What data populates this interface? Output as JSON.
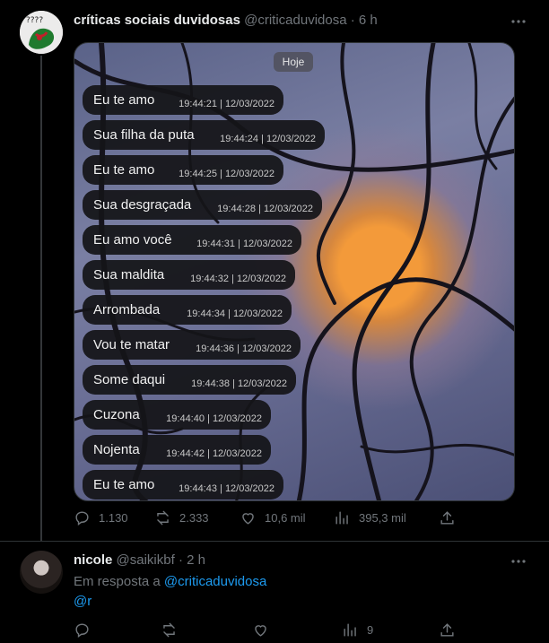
{
  "tweet": {
    "author_name": "críticas sociais duvidosas",
    "handle": "@criticaduvidosa",
    "time": "6 h",
    "media": {
      "day_label": "Hoje",
      "messages": [
        {
          "text": "Eu te amo",
          "timestamp": "19:44:21 | 12/03/2022"
        },
        {
          "text": "Sua filha da puta",
          "timestamp": "19:44:24 | 12/03/2022"
        },
        {
          "text": "Eu te amo",
          "timestamp": "19:44:25 | 12/03/2022"
        },
        {
          "text": "Sua desgraçada",
          "timestamp": "19:44:28 | 12/03/2022"
        },
        {
          "text": "Eu amo você",
          "timestamp": "19:44:31 | 12/03/2022"
        },
        {
          "text": "Sua maldita",
          "timestamp": "19:44:32 | 12/03/2022"
        },
        {
          "text": "Arrombada",
          "timestamp": "19:44:34 | 12/03/2022"
        },
        {
          "text": "Vou te matar",
          "timestamp": "19:44:36 | 12/03/2022"
        },
        {
          "text": "Some daqui",
          "timestamp": "19:44:38 | 12/03/2022"
        },
        {
          "text": "Cuzona",
          "timestamp": "19:44:40 | 12/03/2022"
        },
        {
          "text": "Nojenta",
          "timestamp": "19:44:42 | 12/03/2022"
        },
        {
          "text": "Eu te amo",
          "timestamp": "19:44:43 | 12/03/2022"
        }
      ]
    },
    "stats": {
      "replies": "1.130",
      "retweets": "2.333",
      "likes": "10,6 mil",
      "views": "395,3 mil"
    },
    "icons": [
      "reply-icon",
      "retweet-icon",
      "like-icon",
      "views-icon",
      "share-icon",
      "more-icon"
    ]
  },
  "reply": {
    "author_name": "nicole",
    "handle": "@saikikbf",
    "time": "2 h",
    "reply_prefix": "Em resposta a",
    "reply_to": "@criticaduvidosa",
    "text": "@r",
    "stats": {
      "views": "9"
    }
  },
  "colors": {
    "background": "#000000",
    "text": "#e7e9ea",
    "muted": "#71767b",
    "link": "#1d9bf0",
    "bubble": "#141418"
  }
}
